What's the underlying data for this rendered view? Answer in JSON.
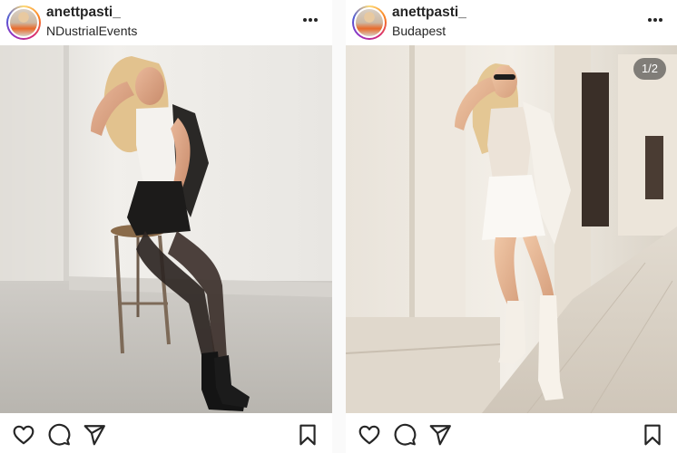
{
  "posts": [
    {
      "username": "anettpasti_",
      "location": "NDustrialEvents",
      "icons": {
        "menu": "more-horizontal-icon",
        "like": "heart-icon",
        "comment": "comment-bubble-icon",
        "share": "paper-plane-icon",
        "save": "bookmark-icon"
      }
    },
    {
      "username": "anettpasti_",
      "location": "Budapest",
      "carousel_counter": "1/2",
      "icons": {
        "menu": "more-horizontal-icon",
        "like": "heart-icon",
        "comment": "comment-bubble-icon",
        "share": "paper-plane-icon",
        "save": "bookmark-icon"
      }
    }
  ],
  "colors": {
    "text": "#262626",
    "story_ring": [
      "#feda75",
      "#fa7e1e",
      "#d62976",
      "#962fbf",
      "#4f5bd5"
    ],
    "background": "#ffffff"
  }
}
